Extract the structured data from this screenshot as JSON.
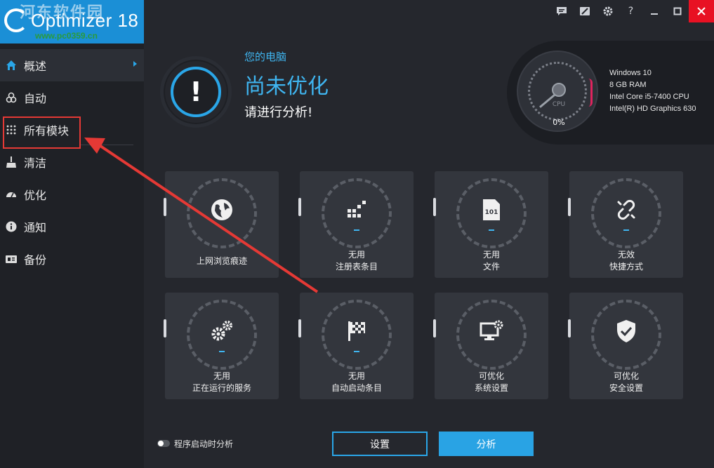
{
  "app": {
    "logo_text": "Optimizer 18",
    "watermark_text": "河东软件园",
    "watermark_url": "www.pc0359.cn"
  },
  "titlebar": {
    "icons": [
      "feedback-icon",
      "skin-icon",
      "gear-icon",
      "help-icon",
      "minimize-icon",
      "maximize-icon",
      "close-icon"
    ],
    "help_label": "?"
  },
  "sidebar": {
    "items": [
      {
        "label": "概述",
        "icon": "home-icon",
        "active": true
      },
      {
        "label": "自动",
        "icon": "auto-icon",
        "active": false
      },
      {
        "label": "所有模块",
        "icon": "grid-icon",
        "active": false
      },
      {
        "label": "清洁",
        "icon": "broom-icon",
        "active": false
      },
      {
        "label": "优化",
        "icon": "speedometer-icon",
        "active": false
      },
      {
        "label": "通知",
        "icon": "info-icon",
        "active": false
      },
      {
        "label": "备份",
        "icon": "backup-icon",
        "active": false
      }
    ]
  },
  "status": {
    "symbol": "!",
    "subtitle": "您的电脑",
    "title": "尚未优化",
    "hint": "请进行分析!"
  },
  "system": {
    "gauge_label": "CPU",
    "gauge_value": "0%",
    "os": "Windows 10",
    "ram": "8 GB RAM",
    "cpu": "Intel Core i5-7400 CPU",
    "gpu": "Intel(R) HD Graphics 630"
  },
  "modules": [
    {
      "line1": "上网浏览痕迹",
      "line2": "",
      "icon": "globe-icon",
      "dash": false
    },
    {
      "line1": "无用",
      "line2": "注册表条目",
      "icon": "registry-icon",
      "dash": true
    },
    {
      "line1": "无用",
      "line2": "文件",
      "icon": "file-icon",
      "dash": true
    },
    {
      "line1": "无效",
      "line2": "快捷方式",
      "icon": "broken-link-icon",
      "dash": true
    },
    {
      "line1": "无用",
      "line2": "正在运行的服务",
      "icon": "gears-icon",
      "dash": true
    },
    {
      "line1": "无用",
      "line2": "自动启动条目",
      "icon": "flag-icon",
      "dash": true
    },
    {
      "line1": "可优化",
      "line2": "系统设置",
      "icon": "monitor-gear-icon",
      "dash": false
    },
    {
      "line1": "可优化",
      "line2": "安全设置",
      "icon": "shield-icon",
      "dash": false
    }
  ],
  "bottom": {
    "toggle_label": "程序启动时分析",
    "settings_label": "设置",
    "analyze_label": "分析"
  },
  "colors": {
    "accent": "#29a3e4",
    "sidebar_bg": "#1f2126",
    "main_bg": "#25272d",
    "card_bg": "#33363d",
    "annotation": "#e53935",
    "close": "#e81123"
  }
}
